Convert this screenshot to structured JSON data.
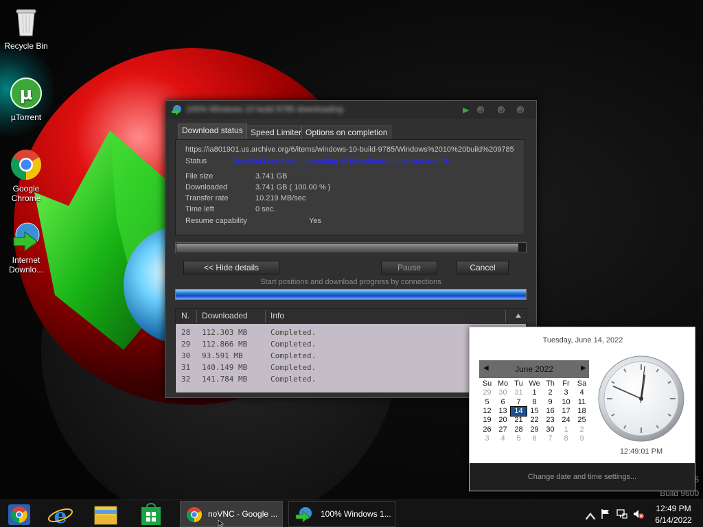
{
  "desktop": {
    "icons": [
      {
        "label": "Recycle Bin"
      },
      {
        "label": "µTorrent"
      },
      {
        "label": "Google Chrome"
      },
      {
        "label": "Internet Downlo..."
      }
    ],
    "build_line1": "5",
    "build_line2": "Build 9600"
  },
  "idm": {
    "tabs": [
      "Download status",
      "Speed Limiter",
      "Options on completion"
    ],
    "url": "https://ia801901.us.archive.org/6/items/windows-10-build-9785/Windows%2010%20build%209785",
    "status_label": "Status",
    "status_value": "Download complete, appending all downloaded parts into one file...",
    "rows": [
      {
        "label": "File size",
        "value": "3.741  GB"
      },
      {
        "label": "Downloaded",
        "value": "3.741  GB  ( 100.00 % )"
      },
      {
        "label": "Transfer rate",
        "value": "10.219  MB/sec"
      },
      {
        "label": "Time left",
        "value": "0 sec."
      },
      {
        "label": "Resume capability",
        "value": "Yes"
      }
    ],
    "progress": 0.98,
    "buttons": {
      "hide_details": "<< Hide details",
      "pause": "Pause",
      "cancel": "Cancel"
    },
    "connections_label": "Start positions and download progress by connections",
    "table": {
      "headers": [
        "N.",
        "Downloaded",
        "Info"
      ],
      "rows": [
        {
          "n": "28",
          "downloaded": "112.303  MB",
          "info": "Completed."
        },
        {
          "n": "29",
          "downloaded": "112.866  MB",
          "info": "Completed."
        },
        {
          "n": "30",
          "downloaded": "93.591  MB",
          "info": "Completed."
        },
        {
          "n": "31",
          "downloaded": "140.149  MB",
          "info": "Completed."
        },
        {
          "n": "32",
          "downloaded": "141.784  MB",
          "info": "Completed."
        }
      ]
    }
  },
  "clock_flyout": {
    "date_header": "Tuesday, June 14, 2022",
    "month_label": "June 2022",
    "weekdays": [
      "Su",
      "Mo",
      "Tu",
      "We",
      "Th",
      "Fr",
      "Sa"
    ],
    "weeks": [
      [
        "29",
        "30",
        "31",
        "1",
        "2",
        "3",
        "4"
      ],
      [
        "5",
        "6",
        "7",
        "8",
        "9",
        "10",
        "11"
      ],
      [
        "12",
        "13",
        "14",
        "15",
        "16",
        "17",
        "18"
      ],
      [
        "19",
        "20",
        "21",
        "22",
        "23",
        "24",
        "25"
      ],
      [
        "26",
        "27",
        "28",
        "29",
        "30",
        "1",
        "2"
      ],
      [
        "3",
        "4",
        "5",
        "6",
        "7",
        "8",
        "9"
      ]
    ],
    "today": "14",
    "time": "12:49:01 PM",
    "change_settings": "Change date and time settings..."
  },
  "taskbar": {
    "tasks": [
      {
        "label": "noVNC - Google ..."
      },
      {
        "label": "100% Windows 1..."
      }
    ],
    "time": "12:49 PM",
    "date": "6/14/2022"
  },
  "colors": {
    "accent_blue": "#1e4f8c",
    "status_link": "#2b2bff",
    "table_bg": "#c4bcc6"
  }
}
